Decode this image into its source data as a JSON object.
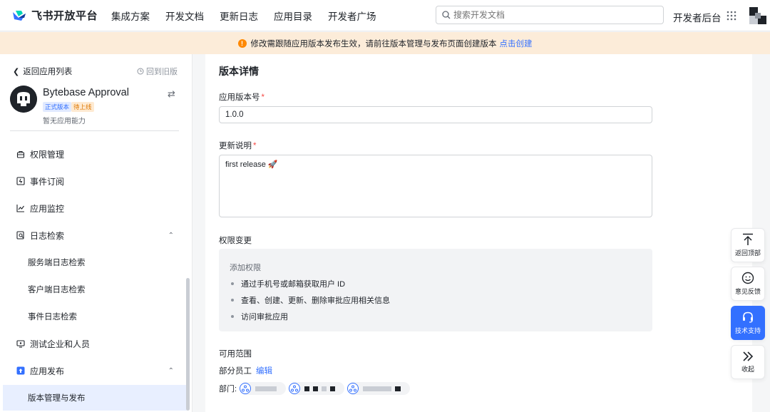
{
  "brand": {
    "name": "飞书开放平台"
  },
  "nav": [
    "集成方案",
    "开发文档",
    "更新日志",
    "应用目录",
    "开发者广场"
  ],
  "search": {
    "placeholder": "搜索开发文档"
  },
  "header": {
    "dev_console": "开发者后台"
  },
  "banner": {
    "text": "修改需跟随应用版本发布生效，请前往版本管理与发布页面创建版本",
    "link": "点击创建"
  },
  "sidebar": {
    "back": "返回应用列表",
    "old_version": "回到旧版",
    "app_name": "Bytebase Approval",
    "tag_online": "正式版本",
    "tag_pending": "待上线",
    "no_ability": "暂无应用能力",
    "items": [
      {
        "label": "权限管理",
        "icon": "lock-icon"
      },
      {
        "label": "事件订阅",
        "icon": "event-icon"
      },
      {
        "label": "应用监控",
        "icon": "chart-icon"
      },
      {
        "label": "日志检索",
        "icon": "log-search-icon"
      },
      {
        "label": "服务端日志检索"
      },
      {
        "label": "客户端日志检索"
      },
      {
        "label": "事件日志检索"
      },
      {
        "label": "测试企业和人员",
        "icon": "test-icon"
      },
      {
        "label": "应用发布",
        "icon": "publish-icon"
      },
      {
        "label": "版本管理与发布"
      }
    ]
  },
  "main": {
    "title": "版本详情",
    "version_label": "应用版本号",
    "version_value": "1.0.0",
    "notes_label": "更新说明",
    "notes_value": "first release 🚀",
    "perm_title": "权限变更",
    "perm_add": "添加权限",
    "perms": [
      "通过手机号或邮箱获取用户 ID",
      "查看、创建、更新、删除审批应用相关信息",
      "访问审批应用"
    ],
    "scope_title": "可用范围",
    "scope_value": "部分员工",
    "scope_edit": "编辑",
    "dept_label": "部门:"
  },
  "floats": [
    "返回顶部",
    "意见反馈",
    "技术支持",
    "收起"
  ],
  "colors": {
    "accent": "#3370ff",
    "banner_bg": "#fcecd9",
    "warn": "#ff8800",
    "required": "#f54a45"
  }
}
